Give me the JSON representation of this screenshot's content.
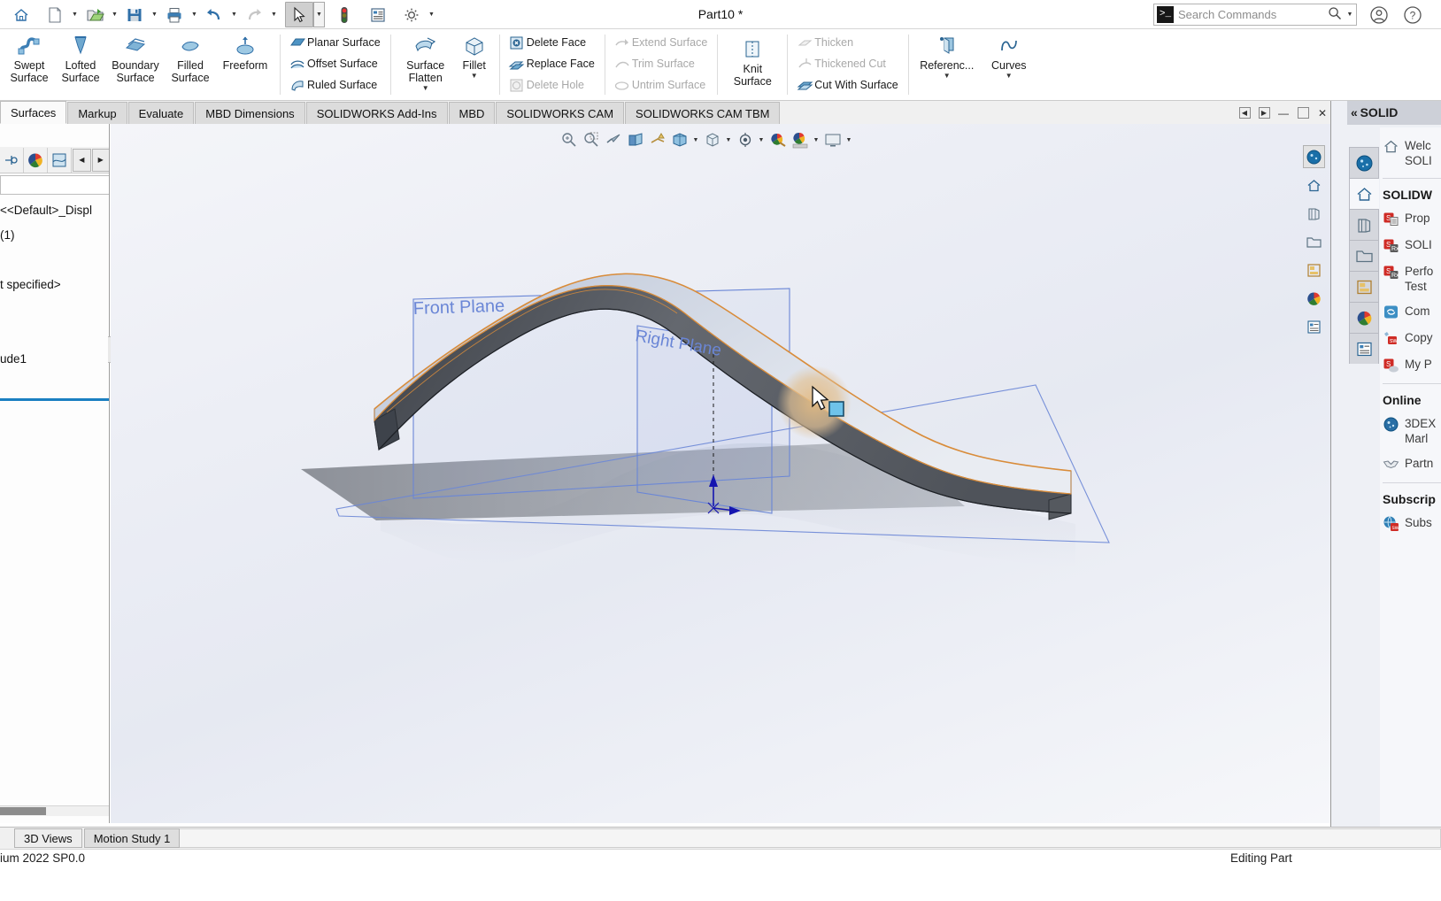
{
  "app": {
    "title": "Part10 *",
    "version_text": "ium 2022 SP0.0",
    "status_text": "Editing Part"
  },
  "quick_access": {
    "buttons": [
      {
        "name": "home-button",
        "icon": "home-icon",
        "caret": false
      },
      {
        "name": "new-document-button",
        "icon": "new-document-icon",
        "caret": true
      },
      {
        "name": "open-document-button",
        "icon": "open-folder-icon",
        "caret": true
      },
      {
        "name": "save-button",
        "icon": "save-disk-icon",
        "caret": true
      },
      {
        "name": "print-button",
        "icon": "printer-icon",
        "caret": true
      },
      {
        "name": "undo-button",
        "icon": "undo-arrow-icon",
        "caret": true
      },
      {
        "name": "redo-button",
        "icon": "redo-arrow-icon",
        "caret": true,
        "disabled": true
      },
      {
        "name": "select-tool-button",
        "icon": "cursor-arrow-icon",
        "caret": true,
        "active": true
      },
      {
        "name": "rebuild-button",
        "icon": "traffic-light-icon",
        "caret": false
      },
      {
        "name": "file-properties-button",
        "icon": "properties-list-icon",
        "caret": false
      },
      {
        "name": "options-button",
        "icon": "gear-icon",
        "caret": true
      }
    ]
  },
  "search": {
    "placeholder": "Search Commands",
    "prompt_glyph": ">_"
  },
  "titlebar_right": {
    "account_icon": "user-account-icon",
    "help_icon": "help-question-icon"
  },
  "ribbon": {
    "big_buttons": [
      {
        "label1": "Swept",
        "label2": "Surface",
        "icon": "swept-surface-icon"
      },
      {
        "label1": "Lofted",
        "label2": "Surface",
        "icon": "lofted-surface-icon"
      },
      {
        "label1": "Boundary",
        "label2": "Surface",
        "icon": "boundary-surface-icon"
      },
      {
        "label1": "Filled",
        "label2": "Surface",
        "icon": "filled-surface-icon"
      },
      {
        "label1": "Freeform",
        "label2": "",
        "icon": "freeform-icon"
      }
    ],
    "group_surface_ops": [
      {
        "label": "Planar Surface",
        "icon": "planar-surface-icon",
        "disabled": false
      },
      {
        "label": "Offset Surface",
        "icon": "offset-surface-icon",
        "disabled": false
      },
      {
        "label": "Ruled Surface",
        "icon": "ruled-surface-icon",
        "disabled": false
      }
    ],
    "surface_flatten": {
      "label1": "Surface",
      "label2": "Flatten",
      "icon": "surface-flatten-icon"
    },
    "fillet": {
      "label1": "Fillet",
      "label2": "",
      "icon": "fillet-icon"
    },
    "group_face_ops": [
      {
        "label": "Delete Face",
        "icon": "delete-face-icon",
        "disabled": false
      },
      {
        "label": "Replace Face",
        "icon": "replace-face-icon",
        "disabled": false
      },
      {
        "label": "Delete Hole",
        "icon": "delete-hole-icon",
        "disabled": true
      }
    ],
    "group_trim_ops": [
      {
        "label": "Extend Surface",
        "icon": "extend-surface-icon",
        "disabled": true
      },
      {
        "label": "Trim Surface",
        "icon": "trim-surface-icon",
        "disabled": true
      },
      {
        "label": "Untrim Surface",
        "icon": "untrim-surface-icon",
        "disabled": true
      }
    ],
    "knit_surface": {
      "label1": "Knit",
      "label2": "Surface",
      "icon": "knit-surface-icon"
    },
    "group_thicken_ops": [
      {
        "label": "Thicken",
        "icon": "thicken-icon",
        "disabled": true
      },
      {
        "label": "Thickened Cut",
        "icon": "thickened-cut-icon",
        "disabled": true
      },
      {
        "label": "Cut With Surface",
        "icon": "cut-with-surface-icon",
        "disabled": false
      }
    ],
    "reference_geometry": {
      "label": "Referenc...",
      "icon": "reference-geometry-icon"
    },
    "curves": {
      "label": "Curves",
      "icon": "curves-icon"
    }
  },
  "command_tabs": [
    {
      "label": "Surfaces",
      "active": true
    },
    {
      "label": "Markup",
      "active": false
    },
    {
      "label": "Evaluate",
      "active": false
    },
    {
      "label": "MBD Dimensions",
      "active": false
    },
    {
      "label": "SOLIDWORKS Add-Ins",
      "active": false
    },
    {
      "label": "MBD",
      "active": false
    },
    {
      "label": "SOLIDWORKS CAM",
      "active": false
    },
    {
      "label": "SOLIDWORKS CAM TBM",
      "active": false
    }
  ],
  "window_controls": [
    {
      "name": "previous-window-button",
      "glyph": "◀"
    },
    {
      "name": "next-window-button",
      "glyph": "▶"
    },
    {
      "name": "minimize-button",
      "glyph": "—"
    },
    {
      "name": "restore-button",
      "glyph": "❐"
    },
    {
      "name": "close-button",
      "glyph": "✕"
    }
  ],
  "feature_manager": {
    "tabs": [
      {
        "name": "feature-tree-tab",
        "icon": "feature-tree-icon"
      },
      {
        "name": "display-manager-tab",
        "icon": "color-wheel-icon"
      },
      {
        "name": "appearances-tab",
        "icon": "appearance-icon"
      }
    ],
    "nav_prev": "◀",
    "nav_next": "▶",
    "tree_rows": [
      "<<Default>_Displ",
      "(1)",
      "",
      "t specified>",
      "",
      "",
      "ude1"
    ]
  },
  "viewport": {
    "hud_buttons": [
      {
        "name": "zoom-to-fit-icon",
        "caret": false
      },
      {
        "name": "zoom-to-area-icon",
        "caret": false
      },
      {
        "name": "previous-view-icon",
        "caret": false
      },
      {
        "name": "section-view-icon",
        "caret": false
      },
      {
        "name": "view-orientation-icon",
        "caret": false
      },
      {
        "name": "display-style-icon",
        "caret": true
      },
      {
        "name": "hide-show-items-icon",
        "caret": true
      },
      {
        "name": "edit-appearance-icon",
        "caret": false
      },
      {
        "name": "apply-scene-icon",
        "caret": true
      },
      {
        "name": "view-settings-icon",
        "caret": true
      }
    ],
    "right_strip": [
      {
        "name": "view-3dexperience-icon",
        "selected": true
      },
      {
        "name": "view-home-icon",
        "selected": false
      },
      {
        "name": "view-model-icon",
        "selected": false
      },
      {
        "name": "view-folder-icon",
        "selected": false
      },
      {
        "name": "view-layout-icon",
        "selected": false
      },
      {
        "name": "view-appearance-icon",
        "selected": false
      },
      {
        "name": "view-properties-icon",
        "selected": false
      }
    ],
    "annotations": [
      {
        "label": "Front Plane",
        "color": "#6a86d6"
      },
      {
        "label": "Right Plane",
        "color": "#6a86d6"
      }
    ],
    "cursor": {
      "badge": "face-select-badge",
      "badge_color": "#4fa8d8"
    },
    "highlight_color": "#e2c296",
    "edge_highlight_color": "#d98c3a",
    "model_face_color": "#c7cedd",
    "model_side_color": "#5a5e66"
  },
  "task_pane": {
    "header": "« SOLID",
    "tabs": [
      {
        "name": "tp-3dexperience-tab",
        "icon": "3dexperience-icon",
        "active": false
      },
      {
        "name": "tp-home-tab",
        "icon": "home-icon",
        "active": true
      },
      {
        "name": "tp-design-library-tab",
        "icon": "design-library-icon",
        "active": false
      },
      {
        "name": "tp-file-explorer-tab",
        "icon": "folder-icon",
        "active": false
      },
      {
        "name": "tp-view-palette-tab",
        "icon": "view-palette-icon",
        "active": false
      },
      {
        "name": "tp-appearances-tab",
        "icon": "color-wheel-icon",
        "active": false
      },
      {
        "name": "tp-custom-properties-tab",
        "icon": "custom-properties-icon",
        "active": false
      }
    ],
    "welcome": {
      "line1": "Welc",
      "line2": "SOLI",
      "icon": "home-icon"
    },
    "sections": [
      {
        "title": "SOLIDW",
        "items": [
          {
            "label": "Prop",
            "icon": "sw-properties-icon"
          },
          {
            "label": "SOLI",
            "icon": "sw-rx-icon"
          },
          {
            "label": "Perfo",
            "label2": "Test ",
            "icon": "sw-rx-perf-icon"
          },
          {
            "label": "Com",
            "icon": "community-icon"
          },
          {
            "label": "Copy",
            "icon": "copy-settings-icon"
          },
          {
            "label": "My P",
            "icon": "my-products-icon"
          }
        ]
      },
      {
        "title": "Online ",
        "items": [
          {
            "label": "3DEX",
            "label2": "Marl",
            "icon": "3dexperience-icon"
          },
          {
            "label": "Partn",
            "icon": "partner-handshake-icon"
          }
        ]
      },
      {
        "title": "Subscrip",
        "items": [
          {
            "label": "Subs",
            "icon": "subscription-icon"
          }
        ]
      }
    ]
  },
  "bottom_tabs": [
    {
      "label": "3D Views",
      "active": true
    },
    {
      "label": "Motion Study 1",
      "active": false
    }
  ]
}
